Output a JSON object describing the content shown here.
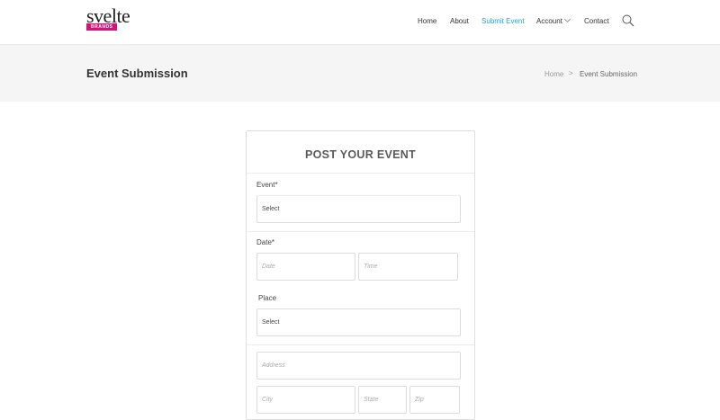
{
  "brand": {
    "word": "svelte",
    "tag": "BRANDS"
  },
  "nav": {
    "home": "Home",
    "about": "About",
    "submit_event": "Submit Event",
    "account": "Account",
    "contact": "Contact"
  },
  "colors": {
    "accent": "#22a6c9",
    "brand_pink": "#d9127a"
  },
  "titlebar": {
    "title": "Event Submission",
    "breadcrumb_home": "Home",
    "breadcrumb_sep": ">",
    "breadcrumb_current": "Event Submission"
  },
  "form": {
    "heading": "POST YOUR EVENT",
    "event_label": "Event*",
    "event_value": "Select",
    "date_label": "Date*",
    "date_placeholder": "Date",
    "time_placeholder": "Time",
    "place_label": "Place",
    "place_value": "Select",
    "address_placeholder": "Address",
    "city_placeholder": "City",
    "state_placeholder": "State",
    "zip_placeholder": "Zip"
  }
}
